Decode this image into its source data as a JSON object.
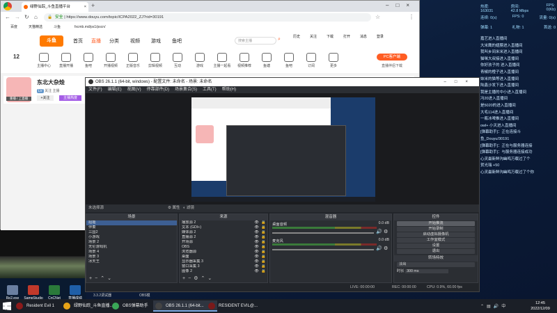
{
  "browser": {
    "tabs": [
      {
        "label": "绿野仙踪_斗鱼直播平台"
      }
    ],
    "address": "https://www.douyu.com/topic/ICPA2022_ZJ?rid=30191",
    "address_secure": "安全",
    "bookmarks": [
      "百度",
      "天猫精选",
      "斗鱼",
      "fxcmb.md/ps1/pscn/"
    ],
    "nav_items": [
      "首页",
      "直播",
      "分类",
      "视频",
      "游戏",
      "鱼吧"
    ],
    "search_placeholder": "搜索主播",
    "top_right": [
      "历史",
      "关注",
      "下载",
      "打开",
      "消息",
      "登录"
    ],
    "categories": [
      {
        "label": "主播中心"
      },
      {
        "label": "直播开播"
      },
      {
        "label": "鱼吧"
      },
      {
        "label": "开播视频"
      },
      {
        "label": "正版音乐"
      },
      {
        "label": "剪辑视频"
      },
      {
        "label": "互动"
      },
      {
        "label": "游戏"
      },
      {
        "label": "主播一起看"
      },
      {
        "label": "视频推荐"
      },
      {
        "label": "鱼塘"
      },
      {
        "label": "鱼吧"
      },
      {
        "label": "订阅"
      },
      {
        "label": "更多"
      }
    ],
    "counter": "12",
    "pc_client": "PC客户端",
    "client_label": "直播伴侣下载",
    "streamer_name": "东北大杂烩",
    "streamer_tags": [
      "LV",
      "关注",
      "主播"
    ],
    "follow_btn": "+关注",
    "hot_badge": "主播热度",
    "avatar_caption": "重播 / 上直播"
  },
  "desktop_icons": [
    {
      "label": "Re2.exe"
    },
    {
      "label": "SampStudio Pro X Dev"
    },
    {
      "label": "CnCNet 8.2.exe"
    },
    {
      "label": "直播成绩"
    }
  ],
  "taskbar": {
    "items": [
      {
        "label": "Resident Evil 1"
      },
      {
        "label": "绿野仙踪_斗鱼直播..."
      },
      {
        "label": "OBS弹幕助手"
      },
      {
        "label": "OBS 26.1.1 (64-bit..."
      },
      {
        "label": "RESIDENT EVIL@..."
      }
    ],
    "time": "12:45",
    "date": "2022/12/09",
    "lang": "中"
  },
  "stats": {
    "rows": [
      {
        "k": "热度:",
        "v": "163031",
        "k2": "房间:",
        "v2": "42.8 Mbps",
        "k3": "FPS:",
        "v3": "0(Kb)"
      },
      {
        "k": "连续:",
        "v": "0(s)",
        "k2": "FPS:",
        "v2": "0",
        "k3": "流量:",
        "v3": "0(s)"
      },
      {
        "k": "弹幕:",
        "v": "1",
        "k2": "礼物:",
        "v2": "1",
        "k3": "首送:",
        "v3": "0"
      }
    ]
  },
  "chat_lines": [
    "嘉艺进入直播间",
    "大米鹰的翅膀进入直播间",
    "我叫乡间米米进入直播间",
    "猫咪大叔接进入直播间",
    "你好孩子的 进入直播间",
    "青椒的橙子进入直播间",
    "妹米的猫等进入直播间",
    "陆鑫沙发下进入直播间",
    "我是主播的中小进入直播间",
    "冯20进入直播间",
    "是5020的进入直播间",
    "大毛114进入直播间",
    "一瓶冰啤推进入直播间",
    "owl+ 小天进入直播间",
    "",
    "[弹幕助手]：正在连接斗",
    "鱼_Douyu/30191",
    "[弹幕助手]：正在与服务器连接",
    "[弹幕助手]：与服务器连接成功",
    "心灵最新鲜沟幽鸣万载过了个",
    "贺光瑞 +50",
    "心灵最新鲜沟幽鸣万载过了个你"
  ],
  "obs": {
    "title": "OBS 26.1.1 (64-bit, windows) - 配置文件: 未命名 - 场景: 未命名",
    "menu": [
      "文件(F)",
      "编辑(E)",
      "视图(V)",
      "停靠部件(D)",
      "场景集合(S)",
      "工具(T)",
      "帮助(H)"
    ],
    "scene_bar_label": "未选择源",
    "scene_bar_props": "属性",
    "scene_bar_filters": "滤镜",
    "docks": {
      "scenes": "场景",
      "sources": "来源",
      "mixer": "混音器",
      "transitions": "转场特效",
      "controls": "控件"
    },
    "scenes": [
      "招摇",
      "伴奏",
      "三国2",
      "小游戏",
      "场景 2",
      "无伦游戏机",
      "场景 4",
      "场景 3",
      "冰天王"
    ],
    "sources": [
      "播放源 2",
      "文本 (GDI+)",
      "媒体源 2",
      "直播源 2",
      "开场源",
      "OBS",
      "浏览器源",
      "桌面",
      "显示器采集 3",
      "窗口采集 3",
      "图像 2"
    ],
    "mixer": [
      {
        "label": "桌面音频",
        "db": "0.0 dB"
      },
      {
        "label": "麦克风",
        "db": "0.0 dB"
      }
    ],
    "transition_type": "淡出",
    "duration_label": "时长",
    "duration_value": "300 ms",
    "controls": [
      "开始推流",
      "开始录制",
      "启动虚拟摄像机",
      "工作室模式",
      "设置",
      "退出"
    ],
    "status": {
      "drop": "LIVE: 00:00:00",
      "rec": "REC: 00:00:00",
      "cpu": "CPU: 0.9%, 60.00 fps"
    },
    "bottom_label": "3.3.2调试器",
    "bottom_label2": "OBS模"
  }
}
